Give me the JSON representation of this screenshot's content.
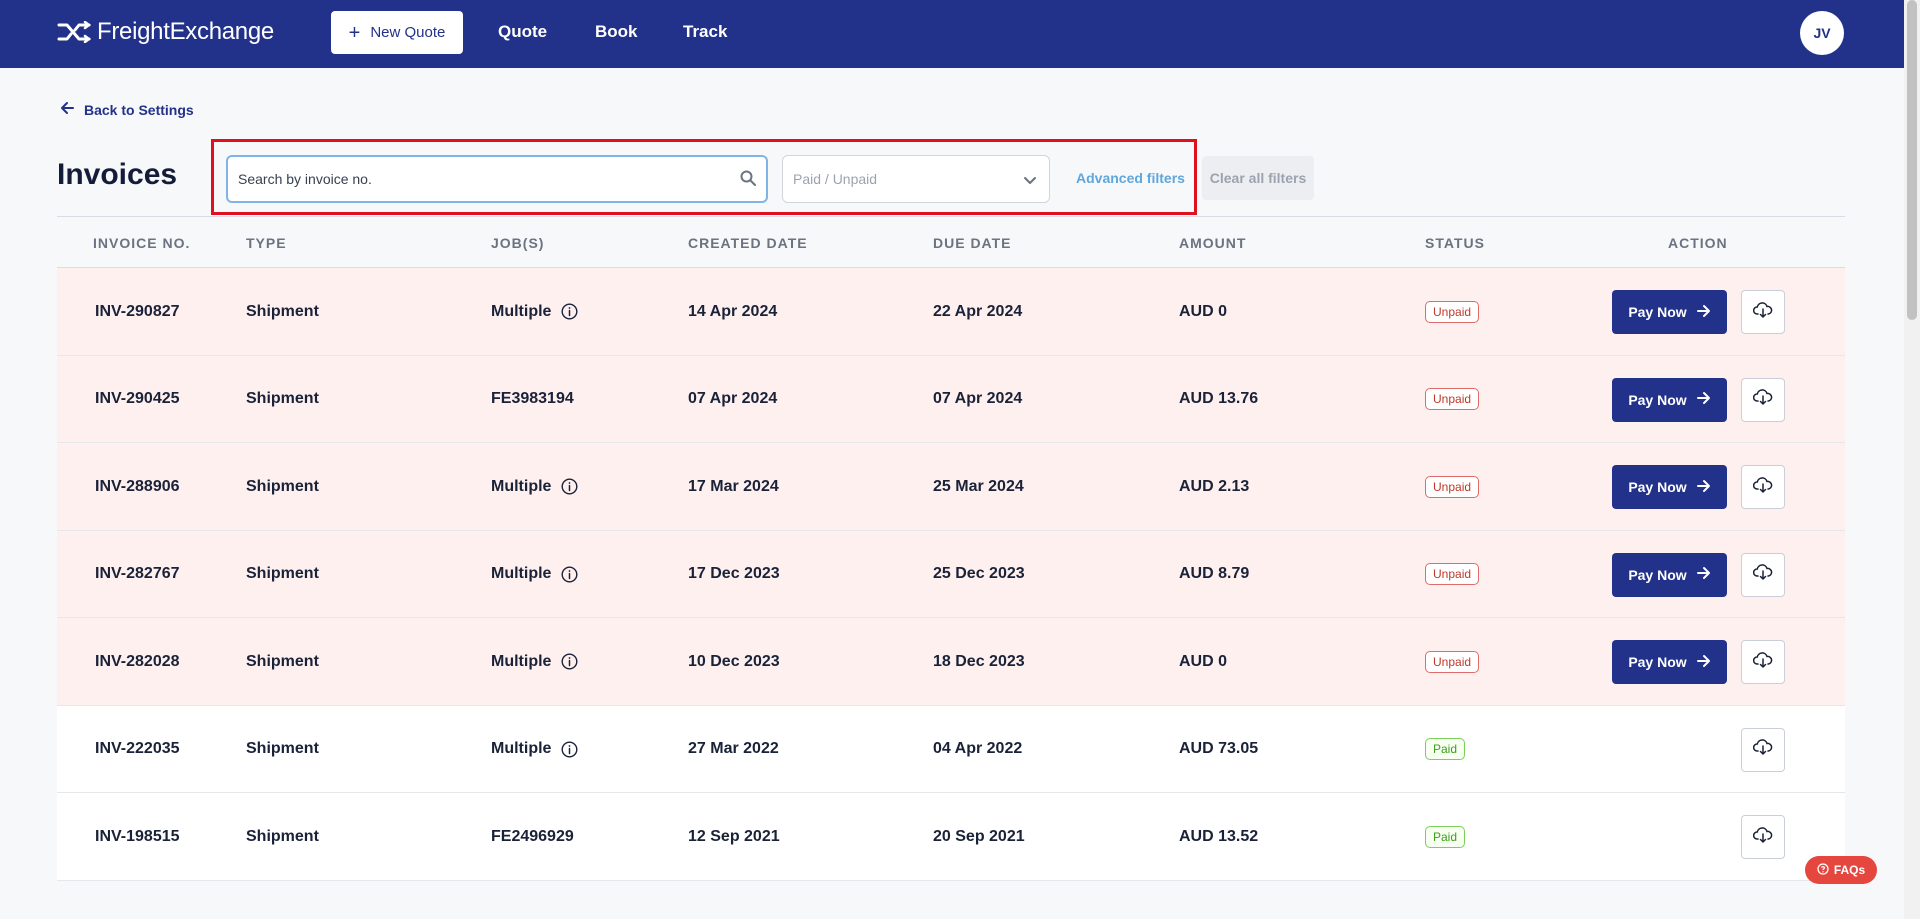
{
  "brand": {
    "name": "FreightExchange"
  },
  "nav": {
    "new_quote_label": "New Quote",
    "links": [
      "Quote",
      "Book",
      "Track"
    ],
    "user_initials": "JV"
  },
  "back_link": "Back to Settings",
  "page_title": "Invoices",
  "filters": {
    "search_placeholder": "Search by invoice no.",
    "status_placeholder": "Paid / Unpaid",
    "advanced_label": "Advanced filters",
    "clear_label": "Clear all filters"
  },
  "table": {
    "headers": [
      "INVOICE NO.",
      "TYPE",
      "JOB(S)",
      "CREATED DATE",
      "DUE DATE",
      "AMOUNT",
      "STATUS",
      "ACTION"
    ],
    "rows": [
      {
        "invoice": "INV-290827",
        "type": "Shipment",
        "jobs": "Multiple",
        "jobs_info": true,
        "created": "14 Apr 2024",
        "due": "22 Apr 2024",
        "amount": "AUD 0",
        "status": "Unpaid"
      },
      {
        "invoice": "INV-290425",
        "type": "Shipment",
        "jobs": "FE3983194",
        "jobs_info": false,
        "created": "07 Apr 2024",
        "due": "07 Apr 2024",
        "amount": "AUD 13.76",
        "status": "Unpaid"
      },
      {
        "invoice": "INV-288906",
        "type": "Shipment",
        "jobs": "Multiple",
        "jobs_info": true,
        "created": "17 Mar 2024",
        "due": "25 Mar 2024",
        "amount": "AUD 2.13",
        "status": "Unpaid"
      },
      {
        "invoice": "INV-282767",
        "type": "Shipment",
        "jobs": "Multiple",
        "jobs_info": true,
        "created": "17 Dec 2023",
        "due": "25 Dec 2023",
        "amount": "AUD 8.79",
        "status": "Unpaid"
      },
      {
        "invoice": "INV-282028",
        "type": "Shipment",
        "jobs": "Multiple",
        "jobs_info": true,
        "created": "10 Dec 2023",
        "due": "18 Dec 2023",
        "amount": "AUD 0",
        "status": "Unpaid"
      },
      {
        "invoice": "INV-222035",
        "type": "Shipment",
        "jobs": "Multiple",
        "jobs_info": true,
        "created": "27 Mar 2022",
        "due": "04 Apr 2022",
        "amount": "AUD 73.05",
        "status": "Paid"
      },
      {
        "invoice": "INV-198515",
        "type": "Shipment",
        "jobs": "FE2496929",
        "jobs_info": false,
        "created": "12 Sep 2021",
        "due": "20 Sep 2021",
        "amount": "AUD 13.52",
        "status": "Paid"
      }
    ],
    "pay_now_label": "Pay Now"
  },
  "faq_label": "FAQs",
  "colors": {
    "nav_bg": "#22318a",
    "unpaid_row_bg": "#fff0f0",
    "unpaid_badge": "#c0392b",
    "paid_badge": "#3e9e1e",
    "highlight_box": "#e0101e",
    "faq_bg": "#e5473f"
  },
  "icons": [
    "logo-icon",
    "plus-icon",
    "arrow-left-icon",
    "search-icon",
    "chevron-down-icon",
    "info-icon",
    "arrow-right-icon",
    "cloud-download-icon",
    "question-icon"
  ]
}
